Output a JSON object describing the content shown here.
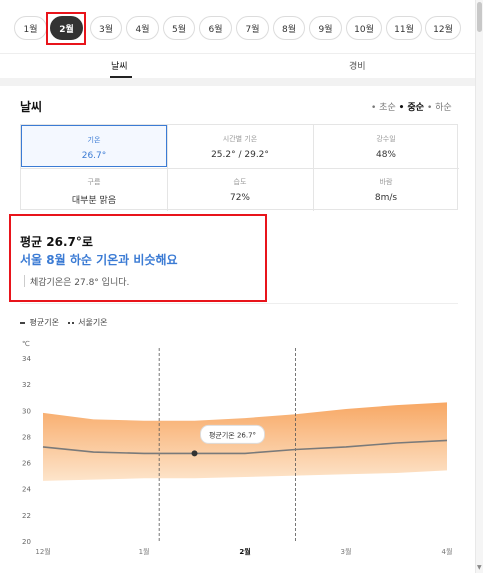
{
  "months": [
    "1월",
    "2월",
    "3월",
    "4월",
    "5월",
    "6월",
    "7월",
    "8월",
    "9월",
    "10월",
    "11월",
    "12월"
  ],
  "active_month_index": 1,
  "tabs": [
    "날씨",
    "경비"
  ],
  "weather": {
    "title": "날씨",
    "tide": {
      "l1": "• 초순",
      "l2": "• 중순",
      "l3": "• 하순"
    },
    "cells": [
      {
        "label": "기온",
        "value": "26.7°"
      },
      {
        "label": "시간별 기온",
        "value": "25.2° / 29.2°"
      },
      {
        "label": "강수일",
        "value": "48%"
      },
      {
        "label": "구름",
        "value": "대부분 맑음"
      },
      {
        "label": "습도",
        "value": "72%"
      },
      {
        "label": "바람",
        "value": "8m/s"
      }
    ]
  },
  "summary": {
    "line1": "평균 26.7°로",
    "line2": "서울 8월 하순 기온과 비슷해요",
    "line3": "체감기온은 27.8° 입니다."
  },
  "chart_legend": {
    "avg": "평균기온",
    "seoul": "서울기온"
  },
  "chart_data": {
    "type": "area",
    "unit": "℃",
    "ylim": [
      20,
      34
    ],
    "yticks": [
      20,
      22,
      24,
      26,
      28,
      30,
      32,
      34
    ],
    "x_ticks": [
      {
        "label": "12월",
        "x": 0
      },
      {
        "label": "1월",
        "x": 1
      },
      {
        "label": "2월",
        "x": 2,
        "bold": true
      },
      {
        "label": "3월",
        "x": 3
      },
      {
        "label": "4월",
        "x": 4
      }
    ],
    "x_range": [
      -0.05,
      4.05
    ],
    "avg_series": {
      "name": "평균기온",
      "x": [
        0,
        0.5,
        1,
        1.5,
        2,
        2.5,
        3,
        3.5,
        4
      ],
      "values": [
        27.2,
        26.8,
        26.7,
        26.7,
        26.7,
        27.0,
        27.2,
        27.5,
        27.7
      ]
    },
    "range_band": {
      "x": [
        0,
        0.5,
        1,
        1.5,
        2,
        2.5,
        3,
        3.5,
        4
      ],
      "low": [
        24.6,
        24.7,
        24.8,
        24.8,
        24.9,
        25.0,
        25.1,
        25.2,
        25.4
      ],
      "high": [
        29.8,
        29.3,
        29.2,
        29.2,
        29.4,
        29.7,
        30.1,
        30.4,
        30.6
      ]
    },
    "marker": {
      "x": 1.5,
      "value": 26.7
    },
    "tooltip": "평균기온 26.7°",
    "dashed_x": [
      1.15,
      2.5
    ]
  },
  "colors": {
    "accent": "#3b7bd4",
    "highlight_red": "#e8141b",
    "band_top": "#f7a35c",
    "band_bottom": "#fde3c8",
    "avg_line": "#7a7a7a"
  }
}
